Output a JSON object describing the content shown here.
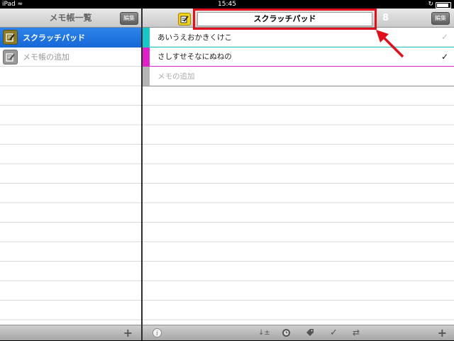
{
  "status_bar": {
    "carrier": "iPad",
    "time": "15:45",
    "battery_level": 0.8
  },
  "sidebar": {
    "title": "メモ帳一覧",
    "edit_label": "編集",
    "items": [
      {
        "label": "スクラッチパッド",
        "selected": true,
        "icon": "notepad-icon"
      },
      {
        "label": "メモ帳の追加",
        "selected": false,
        "icon": "add-notepad-icon"
      }
    ],
    "toolbar": {
      "add_icon": "plus-icon"
    }
  },
  "main": {
    "notepad_title": "スクラッチパッド",
    "count": "8",
    "edit_label": "編集",
    "notes": [
      {
        "text": "あいうえおかきくけこ",
        "color": "#19c7c7",
        "checked": false,
        "check_color": "#bbbbbb"
      },
      {
        "text": "さしすせそなにぬねの",
        "color": "#e020c8",
        "checked": true,
        "check_color": "#111111"
      },
      {
        "text": "メモの追加",
        "color": "#b5b5b5",
        "placeholder": true
      }
    ],
    "toolbar_icons": [
      "info-icon",
      "sort-icon",
      "clock-icon",
      "tag-icon",
      "check-icon",
      "shuffle-icon",
      "plus-icon"
    ]
  },
  "annotation": {
    "highlight_color": "#e0111b"
  }
}
